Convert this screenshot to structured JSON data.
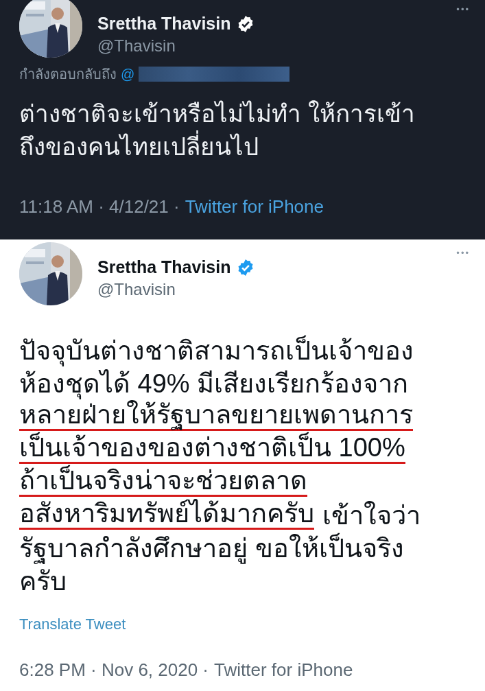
{
  "tweets": [
    {
      "kind": "dark",
      "name": "Srettha Thavisin",
      "verified": true,
      "handle": "@Thavisin",
      "reply_label": "กำลังตอบกลับถึง",
      "reply_mention": "@",
      "reply_redacted": true,
      "body_lines": [
        {
          "segments": [
            {
              "text": "ต่างชาติจะเข้าหรือไม่ไม่ทำ ให้การเข้า",
              "underlined": false
            }
          ]
        },
        {
          "segments": [
            {
              "text": "ถึงของคนไทยเปลี่ยนไป",
              "underlined": false
            }
          ]
        }
      ],
      "timestamp": "11:18 AM · 4/12/21 ·",
      "source": "Twitter for iPhone",
      "source_highlighted": true,
      "more": "•••"
    },
    {
      "kind": "light",
      "name": "Srettha Thavisin",
      "verified": true,
      "handle": "@Thavisin",
      "body_lines": [
        {
          "segments": [
            {
              "text": "ปัจจุบันต่างชาติสามารถเป็นเจ้าของ",
              "underlined": false
            }
          ]
        },
        {
          "segments": [
            {
              "text": "ห้องชุดได้ 49% มีเสียงเรียกร้องจาก",
              "underlined": false
            }
          ]
        },
        {
          "segments": [
            {
              "text": "หลายฝ่ายให้รัฐบาลขยายเพดานการ",
              "underlined": true
            }
          ]
        },
        {
          "segments": [
            {
              "text": "เป็นเจ้าของของต่างชาติเป็น 100%",
              "underlined": true
            }
          ]
        },
        {
          "segments": [
            {
              "text": "ถ้าเป็นจริงน่าจะช่วยตลาด",
              "underlined": true
            }
          ]
        },
        {
          "segments": [
            {
              "text": "อสังหาริมทรัพย์ได้มากครับ",
              "underlined": true
            },
            {
              "text": "เข้าใจว่า",
              "underlined": false
            }
          ]
        },
        {
          "segments": [
            {
              "text": "รัฐบาลกำลังศึกษาอยู่ ขอให้เป็นจริง",
              "underlined": false
            }
          ]
        },
        {
          "segments": [
            {
              "text": "ครับ",
              "underlined": false
            }
          ]
        }
      ],
      "translate": "Translate Tweet",
      "timestamp": "6:28 PM · Nov 6, 2020 ·",
      "source": "Twitter for iPhone",
      "source_highlighted": false,
      "more": "•••"
    }
  ]
}
